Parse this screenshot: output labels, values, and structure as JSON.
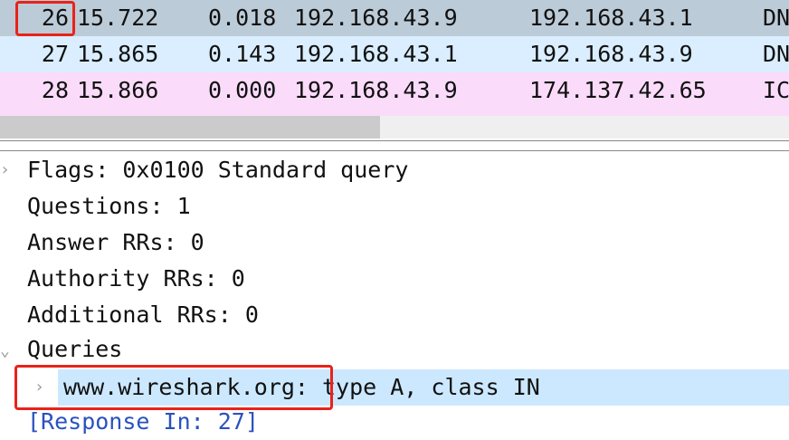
{
  "packets": [
    {
      "no": "26",
      "time": "15.722",
      "delta": "0.018",
      "src": "192.168.43.9",
      "dst": "192.168.43.1",
      "proto": "DNS",
      "bg": "#bccbd8"
    },
    {
      "no": "27",
      "time": "15.865",
      "delta": "0.143",
      "src": "192.168.43.1",
      "dst": "192.168.43.9",
      "proto": "DNS",
      "bg": "#daeeff"
    },
    {
      "no": "28",
      "time": "15.866",
      "delta": "0.000",
      "src": "192.168.43.9",
      "dst": "174.137.42.65",
      "proto": "ICMP",
      "bg": "#fadcfa"
    }
  ],
  "details": {
    "flags": "Flags: 0x0100 Standard query",
    "questions": "Questions: 1",
    "answer_rrs": "Answer RRs: 0",
    "authority_rrs": "Authority RRs: 0",
    "additional_rrs": "Additional RRs: 0",
    "queries": "Queries",
    "query_name": "www.wireshark.org:",
    "query_rest": " type A, class IN",
    "response_in": "[Response In: 27]"
  },
  "colors": {
    "highlight": "#e8231a",
    "selected_detail": "#cce8ff"
  }
}
